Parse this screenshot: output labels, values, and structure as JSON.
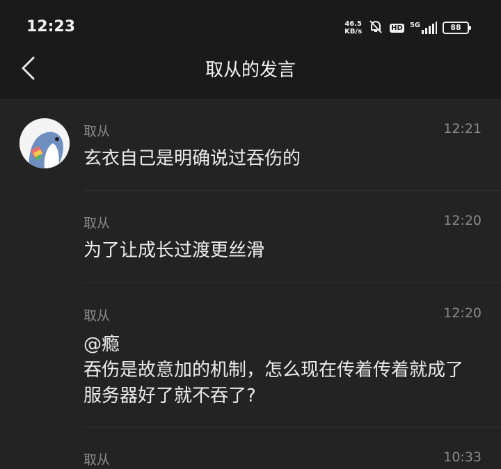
{
  "status_bar": {
    "time": "12:23",
    "net_speed_value": "46.5",
    "net_speed_unit": "KB/s",
    "hd_label": "HD",
    "network": "5G",
    "battery": "88"
  },
  "header": {
    "title": "取从的发言"
  },
  "messages": [
    {
      "author": "取从",
      "time": "12:21",
      "text": "玄衣自己是明确说过吞伤的"
    },
    {
      "author": "取从",
      "time": "12:20",
      "text": "为了让成长过渡更丝滑"
    },
    {
      "author": "取从",
      "time": "12:20",
      "text": "@瘾\n吞伤是故意加的机制，怎么现在传着传着就成了服务器好了就不吞了?"
    },
    {
      "author": "取从",
      "time": "10:33",
      "text": ""
    }
  ],
  "colors": {
    "background": "#232323",
    "header_background": "#1a1a1a",
    "meta_text": "#8a8a8a",
    "body_text": "#ececec"
  }
}
